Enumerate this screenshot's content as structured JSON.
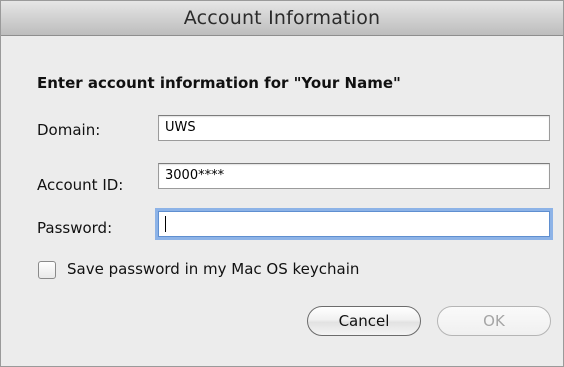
{
  "window": {
    "title": "Account Information"
  },
  "form": {
    "heading": "Enter account information for \"Your Name\"",
    "fields": {
      "domain": {
        "label": "Domain:",
        "value": "UWS"
      },
      "account_id": {
        "label": "Account ID:",
        "value": "3000****"
      },
      "password": {
        "label": "Password:",
        "value": ""
      }
    },
    "keychain_checkbox": {
      "label": "Save password in my Mac OS keychain",
      "checked": false
    }
  },
  "buttons": {
    "cancel_label": "Cancel",
    "ok_label": "OK"
  }
}
